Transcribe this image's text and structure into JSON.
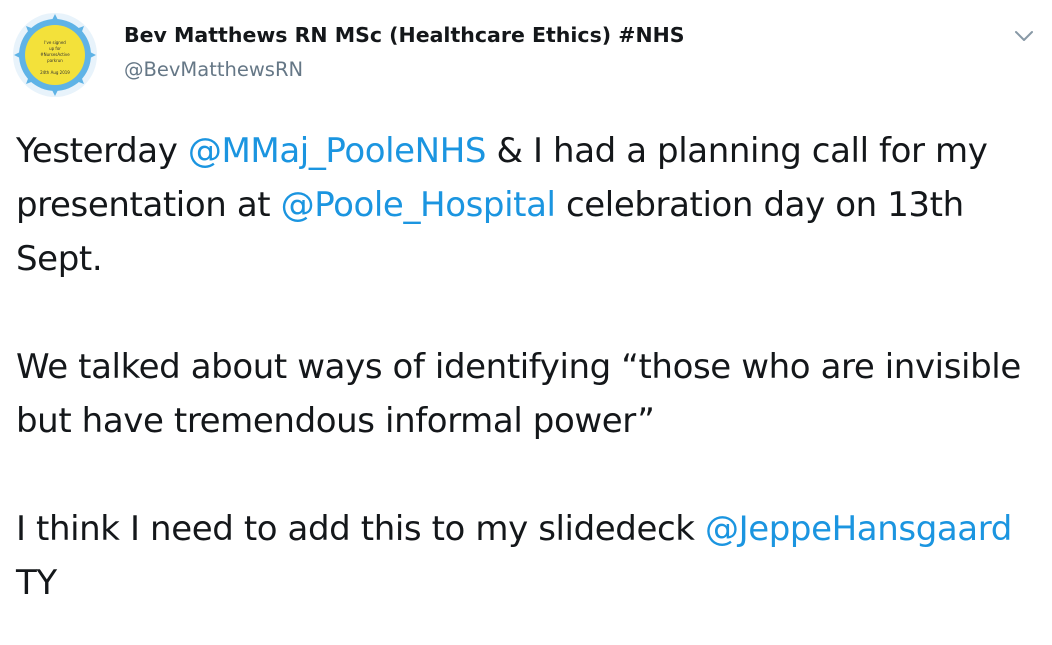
{
  "author": {
    "display_name": "Bev Matthews RN MSc (Healthcare Ethics) #NHS",
    "handle": "@BevMatthewsRN",
    "avatar": {
      "lines": [
        "I've signed",
        "up for",
        "#NursesActive",
        "parkrun",
        "",
        "24th Aug 2019"
      ],
      "badge_color": "#f3e13a",
      "border_color": "#5fb3e6"
    }
  },
  "menu": {
    "icon": "chevron-down-icon"
  },
  "tweet": {
    "p1": {
      "t1": "Yesterday ",
      "m1": "@MMaj_PooleNHS",
      "t2": " & I had a planning call for my presentation at ",
      "m2": "@Poole_Hospital",
      "t3": " celebration day on 13th Sept."
    },
    "p2": {
      "t1": "We talked about ways of identifying “those who are invisible but have tremendous informal power”"
    },
    "p3": {
      "t1": "I think I need to add this to my slidedeck ",
      "m1": "@JeppeHansgaard",
      "t2": " TY"
    }
  },
  "colors": {
    "link": "#1b95e0",
    "text": "#14171a",
    "secondary": "#657786"
  }
}
